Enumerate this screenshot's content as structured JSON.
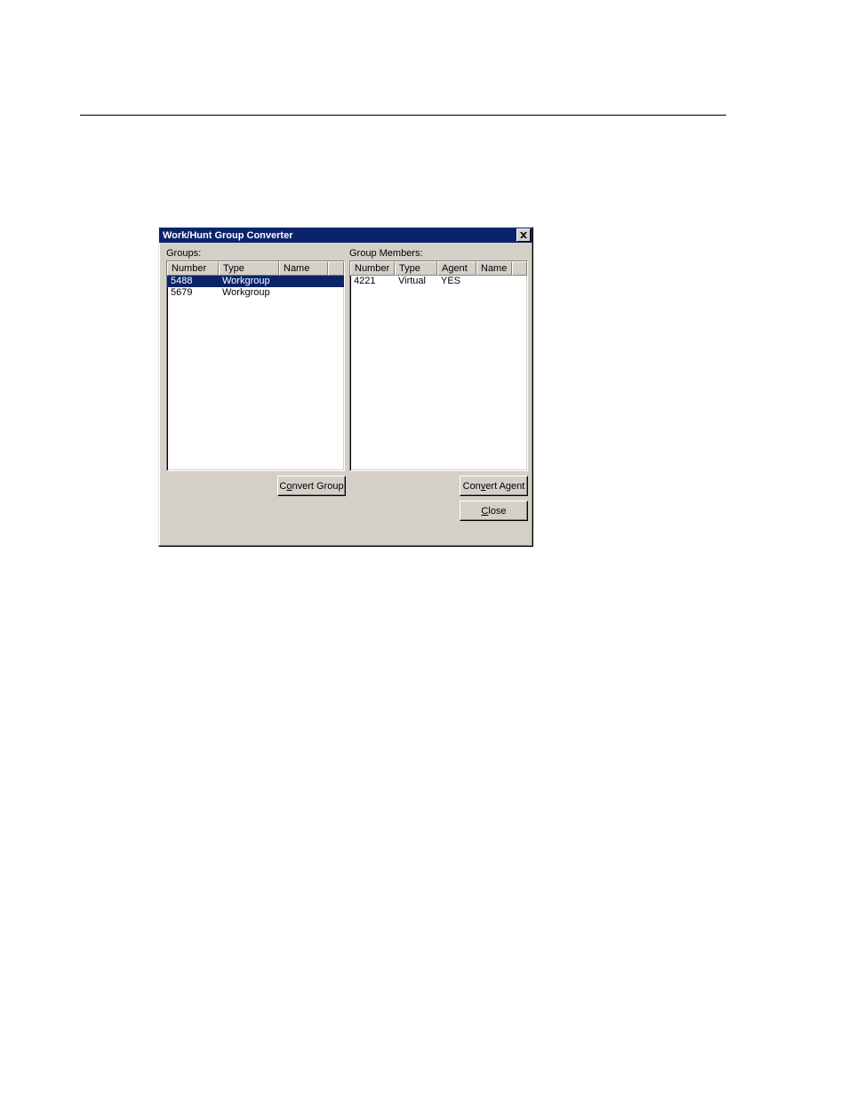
{
  "window": {
    "title": "Work/Hunt Group Converter"
  },
  "labels": {
    "groups": "Groups:",
    "members": "Group Members:"
  },
  "groups_list": {
    "columns": {
      "number": "Number",
      "type": "Type",
      "name": "Name"
    },
    "rows": [
      {
        "number": "5488",
        "type": "Workgroup",
        "name": "",
        "selected": true
      },
      {
        "number": "5679",
        "type": "Workgroup",
        "name": "",
        "selected": false
      }
    ]
  },
  "members_list": {
    "columns": {
      "number": "Number",
      "type": "Type",
      "agent": "Agent",
      "name": "Name"
    },
    "rows": [
      {
        "number": "4221",
        "type": "Virtual",
        "agent": "YES",
        "name": ""
      }
    ]
  },
  "buttons": {
    "convert_group_pre": "C",
    "convert_group_ul": "o",
    "convert_group_post": "nvert Group",
    "convert_agent_pre": "Con",
    "convert_agent_ul": "v",
    "convert_agent_post": "ert Agent",
    "close_pre": "",
    "close_ul": "C",
    "close_post": "lose"
  }
}
